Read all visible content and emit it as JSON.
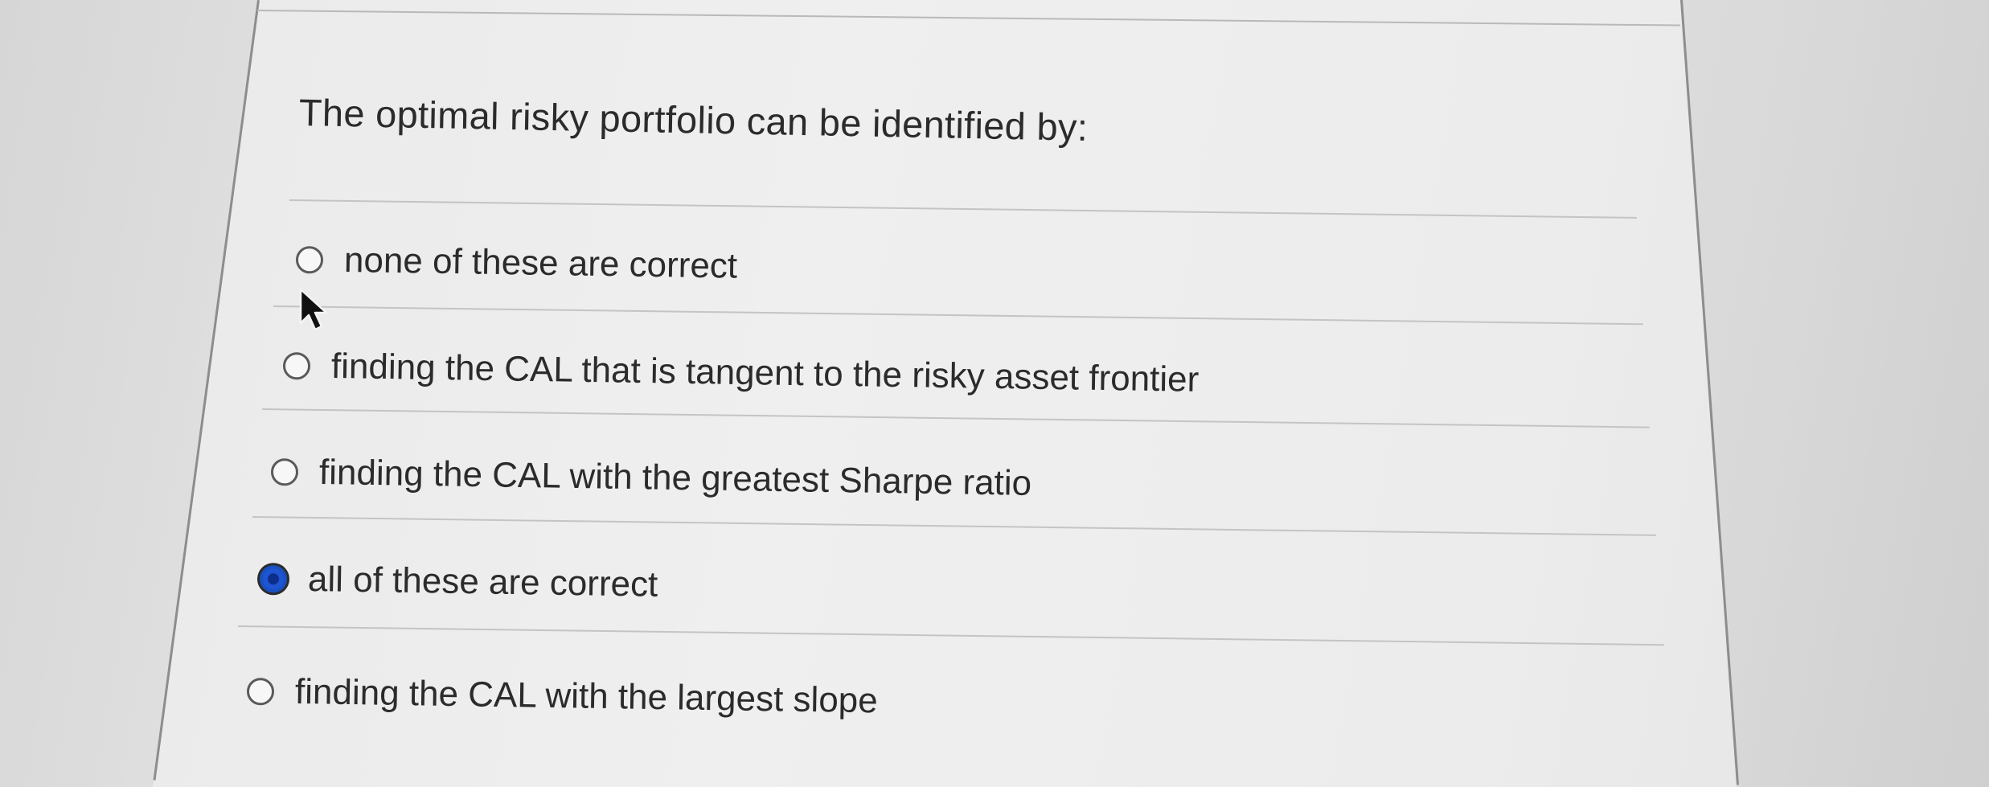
{
  "question": {
    "text": "The optimal risky portfolio can be identified by:"
  },
  "options": [
    {
      "label": "none of these are correct",
      "selected": false
    },
    {
      "label": "finding the CAL that is tangent to the risky asset frontier",
      "selected": false
    },
    {
      "label": "finding the CAL with the greatest Sharpe ratio",
      "selected": false
    },
    {
      "label": "all of these are correct",
      "selected": true
    },
    {
      "label": "finding the CAL with the largest slope",
      "selected": false
    }
  ],
  "colors": {
    "selected_radio": "#1f55d1"
  },
  "cursor": {
    "icon": "mouse-pointer-icon"
  }
}
